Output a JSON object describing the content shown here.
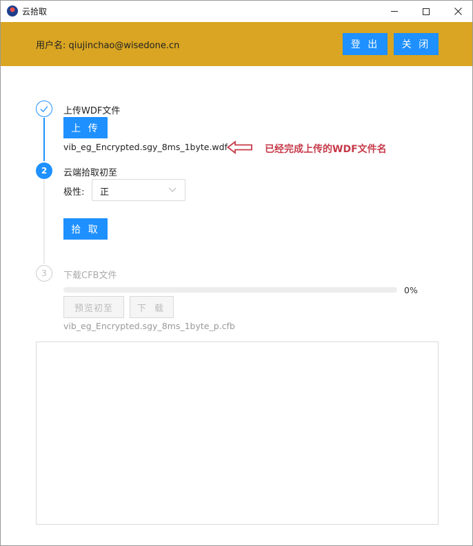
{
  "window": {
    "title": "云拾取",
    "icon": "app-logo-icon"
  },
  "header": {
    "user_label": "用户名: qiujinchao@wisedone.cn",
    "logout_label": "登 出",
    "close_label": "关 闭",
    "background": "#d9a522",
    "button_color": "#1e90ff"
  },
  "steps": [
    {
      "number": "1",
      "title": "上传WDF文件",
      "status": "finished",
      "icon": "check-icon",
      "upload_label": "上 传",
      "filename": "vib_eg_Encrypted.sgy_8ms_1byte.wdf",
      "annotation": "已经完成上传的WDF文件名"
    },
    {
      "number": "2",
      "title": "云端拾取初至",
      "status": "active",
      "polarity_label": "极性:",
      "polarity_value": "正",
      "pick_label": "拾 取"
    },
    {
      "number": "3",
      "title": "下载CFB文件",
      "status": "waiting",
      "progress": 0,
      "progress_text": "0%",
      "preview_label": "预览初至",
      "download_label": "下 载",
      "cfb_filename": "vib_eg_Encrypted.sgy_8ms_1byte_p.cfb"
    }
  ],
  "colors": {
    "primary": "#1e90ff",
    "annotation": "#c63a4a",
    "disabled_text": "#bbbbbb"
  },
  "log": {
    "content": ""
  }
}
